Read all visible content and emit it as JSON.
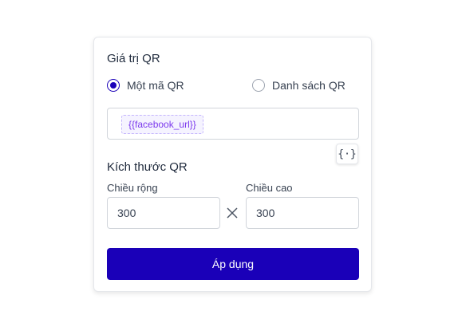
{
  "qr_value": {
    "title": "Giá trị QR",
    "options": [
      {
        "label": "Một mã QR",
        "checked": true
      },
      {
        "label": "Danh sách QR",
        "checked": false
      }
    ],
    "tag": "{{facebook_url}}",
    "variable_button_glyph": "{·}"
  },
  "qr_size": {
    "title": "Kích thước QR",
    "width_label": "Chiều rộng",
    "width_value": "300",
    "height_label": "Chiều cao",
    "height_value": "300"
  },
  "apply_button": {
    "label": "Áp dụng"
  },
  "colors": {
    "accent": "#1a00b8",
    "tag_text": "#7c3aed"
  }
}
